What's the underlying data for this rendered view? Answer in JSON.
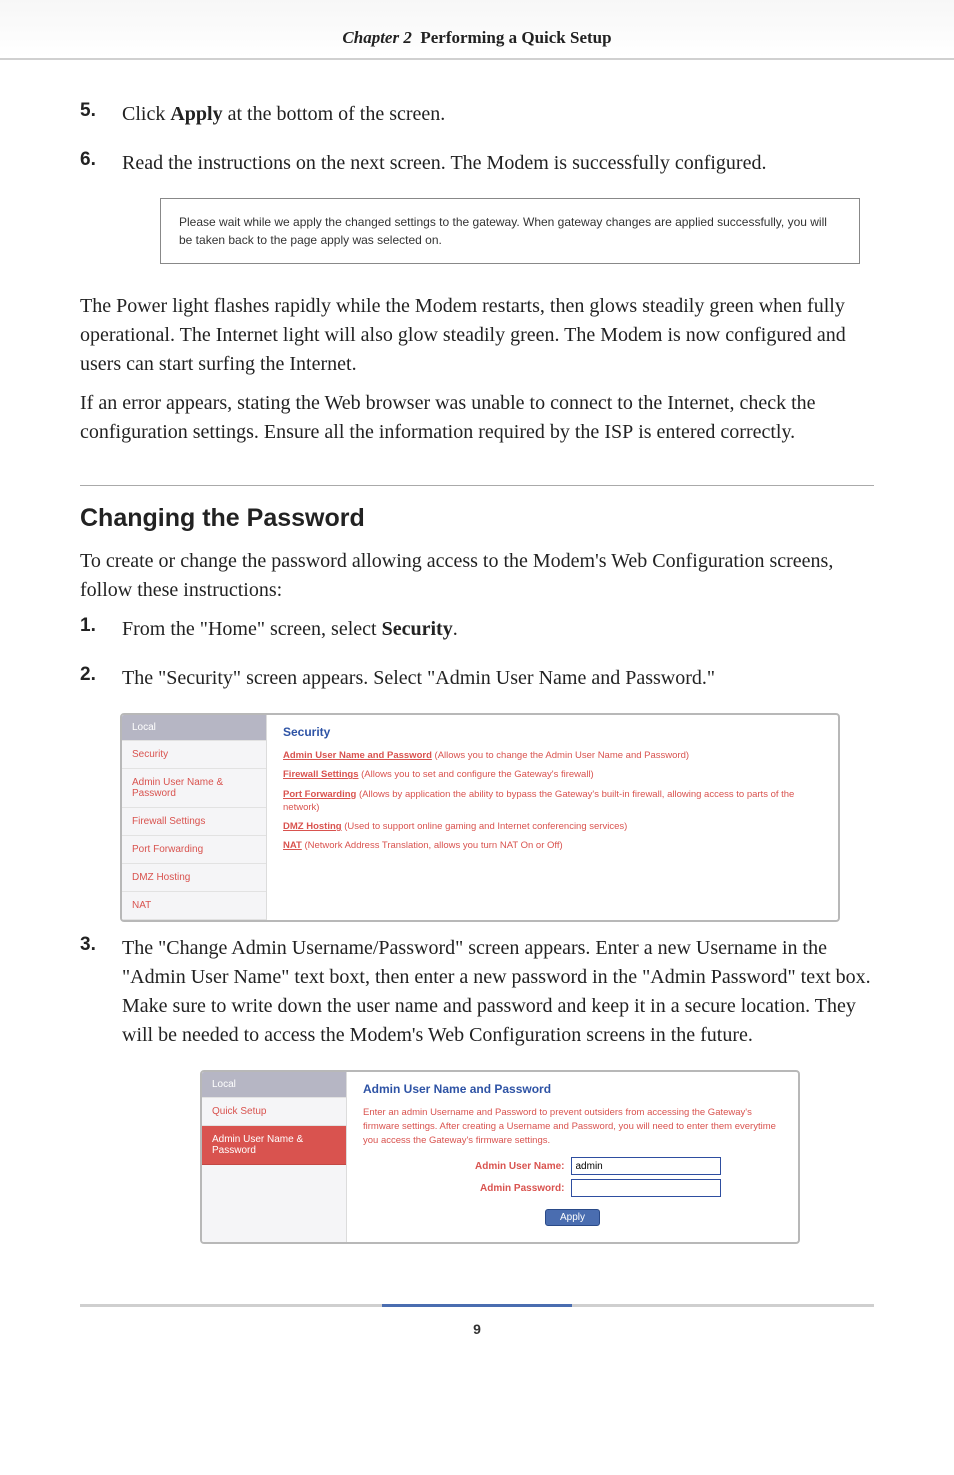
{
  "header": {
    "chapter_label": "Chapter 2",
    "chapter_title": "Performing a Quick Setup"
  },
  "steps_a": [
    {
      "num": "5.",
      "html": "Click <b>Apply</b> at the bottom of the screen."
    },
    {
      "num": "6.",
      "html": "Read the instructions on the next screen. The Modem is successfully configured."
    }
  ],
  "callout": "Please wait while we apply the changed settings to the gateway. When gateway changes are applied successfully, you will be taken back to the page apply was selected on.",
  "para1": "The Power light flashes rapidly while the Modem restarts, then glows steadily green when fully operational. The Internet light will also glow steadily green. The Modem is now configured and users can start surfing the Internet.",
  "para2_html": "If an error appears, stating the Web browser was unable to connect to the Internet, check the configuration settings. Ensure all the information required by the <span class=\"smallcaps\">ISP</span> is entered correctly.",
  "section2": {
    "heading": "Changing the Password",
    "intro": "To create or change the password allowing access to the Modem's Web Configuration screens, follow these instructions:"
  },
  "steps_b": [
    {
      "num": "1.",
      "html": "From the \"Home\" screen, select <b>Security</b>."
    },
    {
      "num": "2.",
      "html": "The \"Security\" screen appears. Select \"Admin User Name and Password.\""
    },
    {
      "num": "3.",
      "html": "The \"Change Admin Username/Password\" screen appears. Enter a new Username in the \"Admin User Name\" text boxt, then enter a new password in the \"Admin Password\" text box. Make sure to write down the user name and password and keep it in a secure location. They will be needed to access the Modem's Web Configuration screens in the future."
    }
  ],
  "security_shot": {
    "sidebar_local": "Local",
    "sidebar": [
      "Security",
      "Admin User Name & Password",
      "Firewall Settings",
      "Port Forwarding",
      "DMZ Hosting",
      "NAT"
    ],
    "title": "Security",
    "rows": [
      {
        "link": "Admin User Name and Password",
        "desc": "(Allows you to change the Admin User Name and Password)"
      },
      {
        "link": "Firewall Settings",
        "desc": "(Allows you to set and configure the Gateway's firewall)"
      },
      {
        "link": "Port Forwarding",
        "desc": "(Allows by application the ability to bypass the Gateway's built-in firewall, allowing access to parts of the network)"
      },
      {
        "link": "DMZ Hosting",
        "desc": "(Used to support online gaming and Internet conferencing services)"
      },
      {
        "link": "NAT",
        "desc": "(Network Address Translation, allows you turn NAT On or Off)"
      }
    ]
  },
  "admin_shot": {
    "sidebar_local": "Local",
    "sidebar": [
      "Quick Setup",
      "Admin User Name & Password"
    ],
    "sidebar_active_index": 1,
    "title": "Admin User Name and Password",
    "desc": "Enter an admin Username and Password to prevent outsiders from accessing the Gateway's firmware settings. After creating a Username and Password, you will need to enter them everytime you access the Gateway's firmware settings.",
    "label_user": "Admin User Name:",
    "label_pass": "Admin Password:",
    "value_user": "admin",
    "value_pass": "",
    "apply": "Apply"
  },
  "footer": {
    "page": "9"
  }
}
